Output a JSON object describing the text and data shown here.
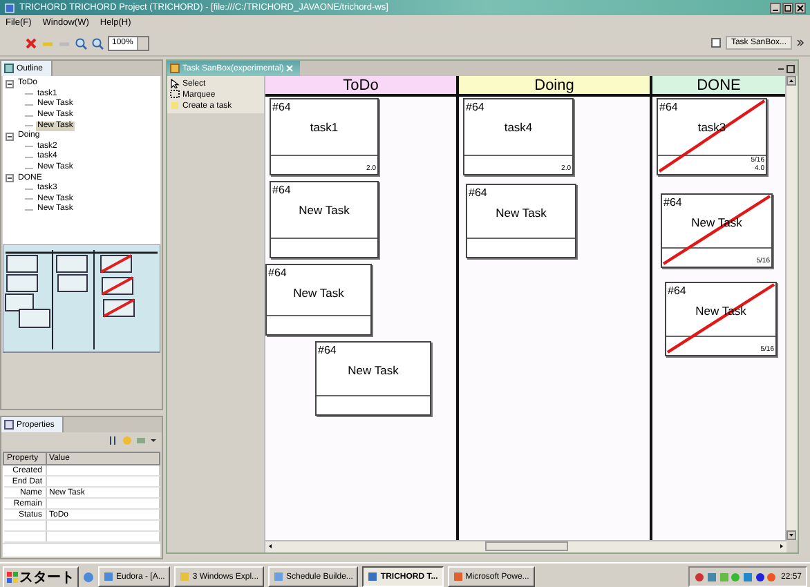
{
  "window": {
    "title": "TRICHORD TRICHORD Project (TRICHORD) - [file:///C:/TRICHORD_JAVAONE/trichord-ws]"
  },
  "menu": [
    "File(F)",
    "Window(W)",
    "Help(H)"
  ],
  "toolbar": {
    "zoom": "100%",
    "perspective": "Task SanBox..."
  },
  "outline": {
    "tab": "Outline",
    "tree": [
      {
        "label": "ToDo",
        "expanded": true,
        "selected": false,
        "children": [
          {
            "label": "task1",
            "selected": false
          },
          {
            "label": "New Task",
            "selected": false
          },
          {
            "label": "New Task",
            "selected": false
          },
          {
            "label": "New Task",
            "selected": true
          }
        ]
      },
      {
        "label": "Doing",
        "expanded": true,
        "selected": false,
        "children": [
          {
            "label": "task2",
            "selected": false
          },
          {
            "label": "task4",
            "selected": false
          },
          {
            "label": "New Task",
            "selected": false
          }
        ]
      },
      {
        "label": "DONE",
        "expanded": true,
        "selected": false,
        "children": [
          {
            "label": "task3",
            "selected": false
          },
          {
            "label": "New Task",
            "selected": false
          },
          {
            "label": "New Task",
            "selected": false
          }
        ]
      }
    ]
  },
  "properties": {
    "tab": "Properties",
    "columns": [
      "Property",
      "Value"
    ],
    "rows": [
      {
        "property": "Created"
      },
      {
        "property": "End Dat"
      },
      {
        "property": "Name",
        "value": "New Task"
      },
      {
        "property": "Remain"
      },
      {
        "property": "Status",
        "value": "ToDo"
      }
    ]
  },
  "editor": {
    "tab": "Task SanBox(experimental)",
    "palette": [
      {
        "label": "Select",
        "kind": "select"
      },
      {
        "label": "Marquee",
        "kind": "marquee"
      },
      {
        "label": "Create a task",
        "kind": "task"
      }
    ],
    "columns": [
      {
        "title": "ToDo",
        "color": "#f8d8f6",
        "cards": [
          {
            "number": "#64",
            "name": "task1",
            "footer": [
              "2.0"
            ],
            "completed": false
          },
          {
            "number": "#64",
            "name": "New Task",
            "completed": false
          },
          {
            "number": "#64",
            "name": "New Task",
            "completed": false
          },
          {
            "number": "#64",
            "name": "New Task",
            "completed": false
          }
        ]
      },
      {
        "title": "Doing",
        "color": "#fbfbc8",
        "cards": [
          {
            "number": "#64",
            "name": "task4",
            "footer": [
              "2.0"
            ],
            "completed": false
          },
          {
            "number": "#64",
            "name": "New Task",
            "completed": false
          }
        ]
      },
      {
        "title": "DONE",
        "color": "#d6f4df",
        "cards": [
          {
            "number": "#64",
            "name": "task3",
            "footer": [
              "5/16",
              "4.0"
            ],
            "completed": true
          },
          {
            "number": "#64",
            "name": "New Task",
            "footer": [
              "5/16"
            ],
            "completed": true
          },
          {
            "number": "#64",
            "name": "New Task",
            "footer": [
              "5/16"
            ],
            "completed": true
          }
        ]
      }
    ]
  },
  "taskbar": {
    "start": "スタート",
    "items": [
      {
        "label": "Eudora - [A...",
        "selected": false
      },
      {
        "label": "3 Windows Expl...",
        "selected": false
      },
      {
        "label": "Schedule Builde...",
        "selected": false
      },
      {
        "label": "TRICHORD T...",
        "selected": true
      },
      {
        "label": "Microsoft Powe...",
        "selected": false
      }
    ],
    "clock": "22:57"
  }
}
